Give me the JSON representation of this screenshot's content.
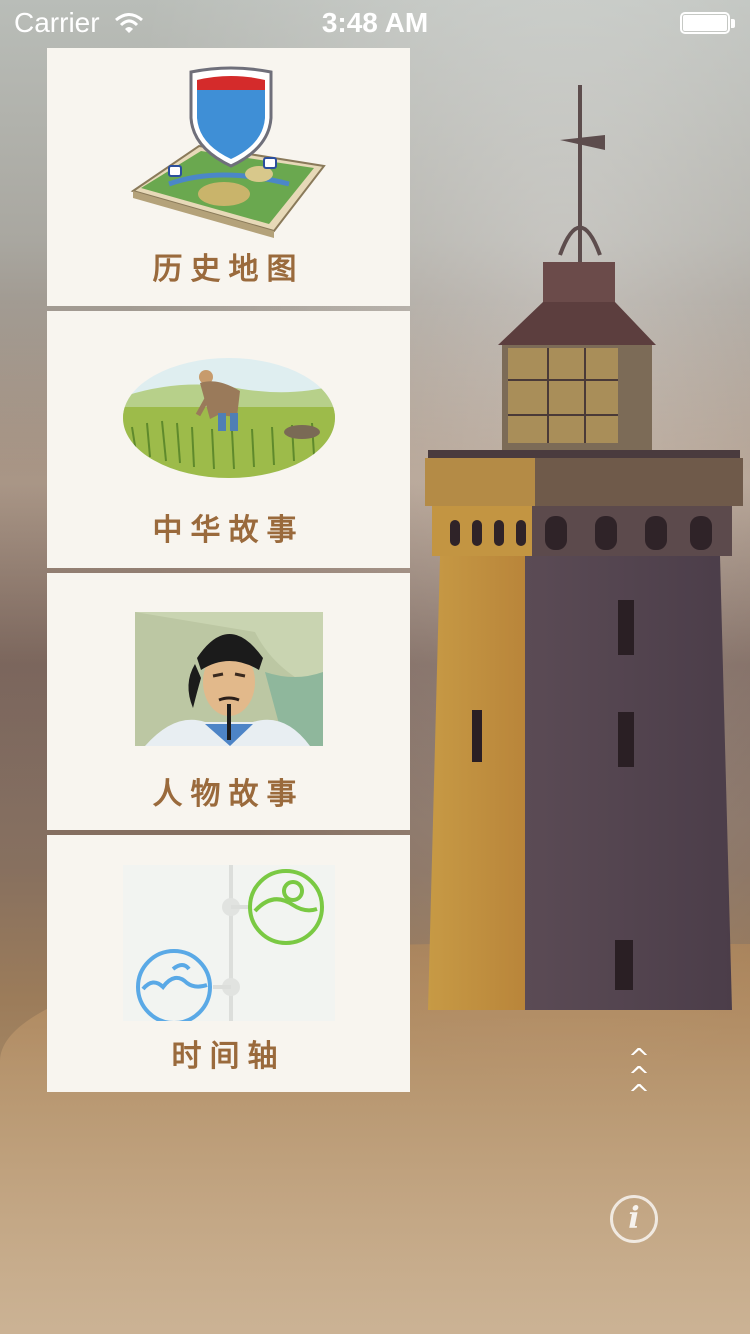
{
  "status_bar": {
    "carrier": "Carrier",
    "time": "3:48 AM"
  },
  "menu": {
    "items": [
      {
        "label": "历史地图",
        "icon": "map-shield-icon"
      },
      {
        "label": "中华故事",
        "icon": "farmer-field-illustration"
      },
      {
        "label": "人物故事",
        "icon": "historical-figure-portrait"
      },
      {
        "label": "时间轴",
        "icon": "timeline-icon"
      }
    ]
  },
  "scroll_hint_icon": "up-chevrons-icon",
  "info_label": "i",
  "colors": {
    "card_background": "#f8f5ef",
    "label_text": "#9a6a3c",
    "timeline_green": "#7ac943",
    "timeline_blue": "#5aa9e6"
  }
}
